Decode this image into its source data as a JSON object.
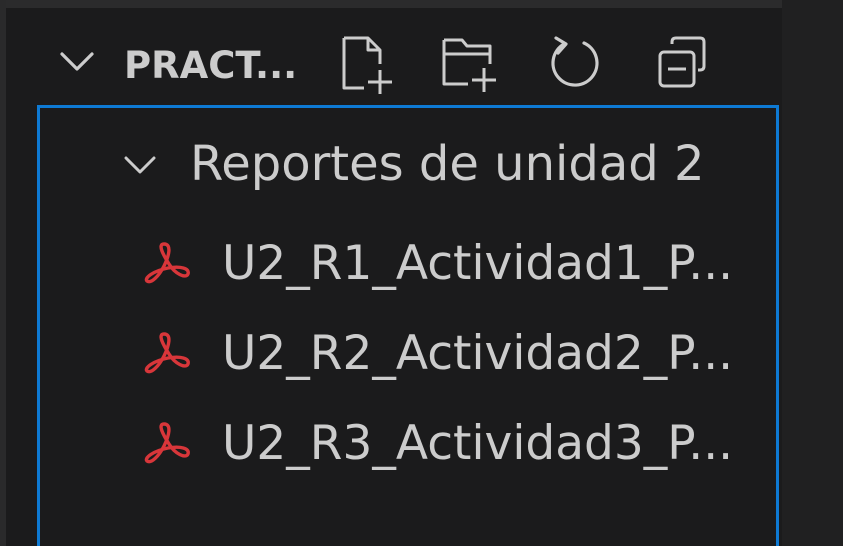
{
  "explorer": {
    "section_title": "PRACT...",
    "actions": [
      {
        "name": "new-file",
        "icon": "new-file-icon"
      },
      {
        "name": "new-folder",
        "icon": "new-folder-icon"
      },
      {
        "name": "refresh",
        "icon": "refresh-icon"
      },
      {
        "name": "collapse-all",
        "icon": "collapse-all-icon"
      }
    ],
    "folder": {
      "label": "Reportes de unidad 2",
      "expanded": true
    },
    "files": [
      {
        "label": "U2_R1_Actividad1_P...",
        "icon": "pdf-icon"
      },
      {
        "label": "U2_R2_Actividad2_P...",
        "icon": "pdf-icon"
      },
      {
        "label": "U2_R3_Actividad3_P...",
        "icon": "pdf-icon"
      }
    ]
  },
  "colors": {
    "background": "#1b1b1c",
    "text": "#cccccc",
    "focus_border": "#0e7ad4",
    "pdf_icon": "#d8363a"
  }
}
